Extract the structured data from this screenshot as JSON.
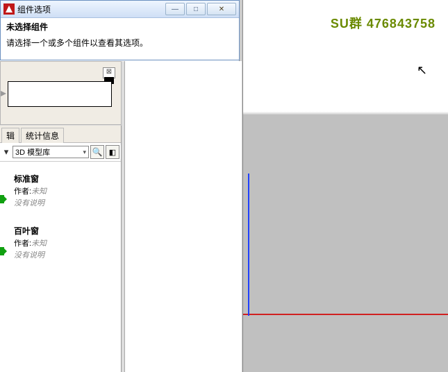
{
  "viewport": {
    "overlay_text": "SU群 476843758"
  },
  "options_dialog": {
    "title": "组件选项",
    "heading": "未选择组件",
    "message": "请选择一个或多个组件以查看其选项。"
  },
  "components_panel": {
    "tabs": {
      "edit": "辑",
      "stats": "统计信息"
    },
    "search_placeholder": "3D 模型库",
    "items": [
      {
        "name": "标准窗",
        "author_label": "作者:",
        "author": "未知",
        "desc": "没有说明"
      },
      {
        "name": "百叶窗",
        "author_label": "作者:",
        "author": "未知",
        "desc": "没有说明"
      }
    ]
  },
  "icons": {
    "minimize": "—",
    "maximize": "□",
    "close": "✕",
    "close_small": "⊠",
    "dropdown": "▾",
    "search": "🔍",
    "panel_toggle": "◧",
    "nav_right": "▸",
    "cursor": "↖"
  }
}
